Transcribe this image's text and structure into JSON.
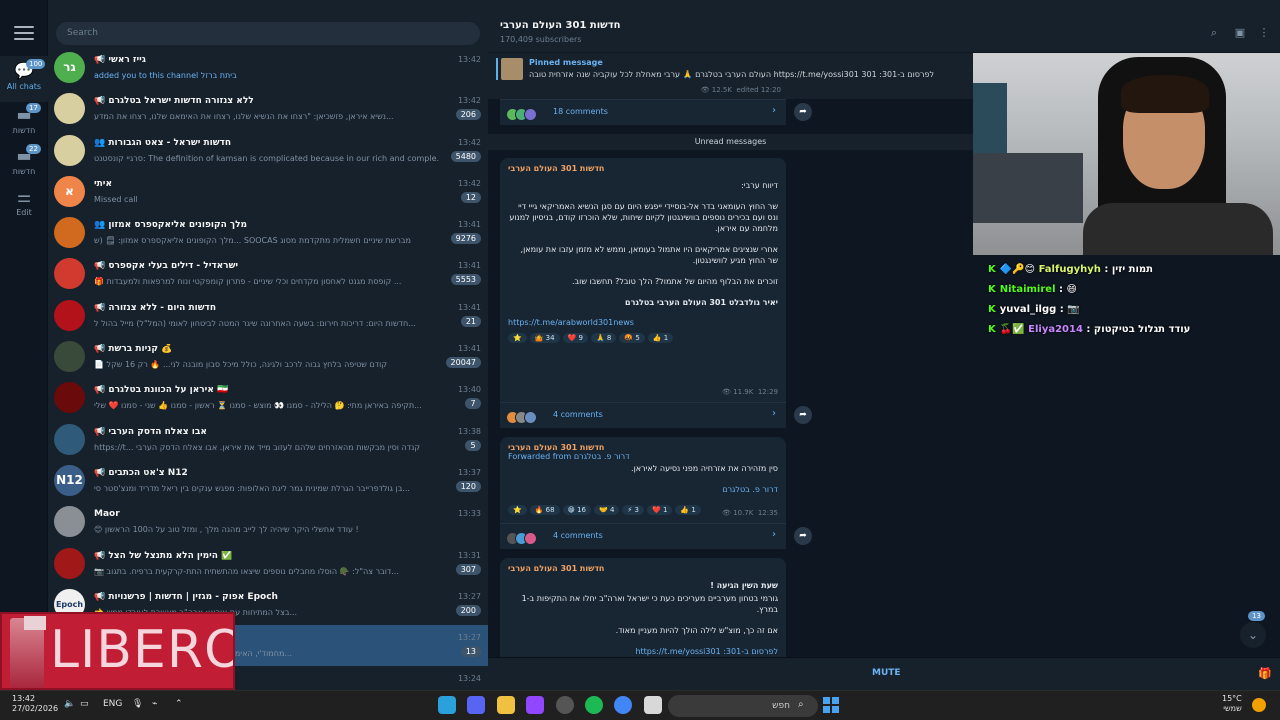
{
  "sidebar": {
    "folders": [
      {
        "label": "All chats",
        "count": "100",
        "icon": "chat-bubbles-icon"
      },
      {
        "label": "חדשות",
        "count": "17",
        "icon": "folder-icon"
      },
      {
        "label": "חדשות",
        "count": "22",
        "icon": "folder-icon"
      },
      {
        "label": "Edit",
        "count": "",
        "icon": "sliders-icon"
      }
    ]
  },
  "search": {
    "placeholder": "Search"
  },
  "chats": [
    {
      "title": "📢 גייז ראשי",
      "snippet": "added you to this channel ביתת ברזל",
      "time": "13:42",
      "badge": "",
      "avatar_text": "גר",
      "avatar_color": "#4fae4e",
      "blue": true
    },
    {
      "title": "📢 ללא צנזורה חדשות ישראל בטלגרם",
      "snippet": "נשיא איראן, פזשכיאן: \"רצחו את הנשיא שלנו, רצחו את האימאם שלנו, רצחו את המדע...",
      "time": "13:42",
      "badge": "206",
      "avatar_text": "",
      "avatar_color": "#d8cfa0",
      "blue": false
    },
    {
      "title": "👥 חדשות ישראל - צאט הגבורות",
      "snippet": "סרגיי קונסטנט: The definition of kamsan is complicated because in our rich and comple...",
      "time": "13:42",
      "badge": "5480",
      "avatar_text": "",
      "avatar_color": "#d8cfa0",
      "blue": false
    },
    {
      "title": "איתי",
      "snippet": "Missed call",
      "time": "13:42",
      "badge": "12",
      "avatar_text": "א",
      "avatar_color": "#f0854a",
      "blue": false
    },
    {
      "title": "👥 מלך הקופונים אליאקספרס אמזון",
      "snippet": "מלך הקופונים אליאקספרס אמזון: 🗒 (ש... SOOCAS מברשת שיניים חשמלית מתקדמת מסוג",
      "time": "13:41",
      "badge": "9276",
      "avatar_text": "",
      "avatar_color": "#d1691f",
      "blue": false
    },
    {
      "title": "📢 ישראדיל - דילים בעלי אקספרס",
      "snippet": "🎁 קופסת מגנט לאחסון מקדחים וכלי שיניים - פתרון קומפקטי ונוח למרפאות ולמעבדות ...",
      "time": "13:41",
      "badge": "5553",
      "avatar_text": "",
      "avatar_color": "#d03a2f",
      "blue": false
    },
    {
      "title": "📢 חדשות היום - ללא צנזורה",
      "snippet": "חדשות היום: דריכות חירום: בשעה האחרונה שיגר המטה לביטחון לאומי (המל\"ל) מייל בהול ל...",
      "time": "13:41",
      "badge": "21",
      "avatar_text": "",
      "avatar_color": "#b3121a",
      "blue": false
    },
    {
      "title": "📢 קניות ברשת 💰",
      "snippet": "📄 קודם שטיפה בלחץ גבוה לרכב ולגינה, כולל מיכל סבון מובנה לני... 🔥 רק 16 שקל",
      "time": "13:41",
      "badge": "20047",
      "avatar_text": "",
      "avatar_color": "#3a4a3a",
      "blue": false
    },
    {
      "title": "📢 איראן על הכוונת בטלגרם 🇮🇷",
      "snippet": "תקיפה באיראן מתי: 🤔 הלילה - סמנו 👀 מוצש - סמנו ⏳ ראשון - סמנו 👍 שני - סמנו ❤️ שלי...",
      "time": "13:40",
      "badge": "7",
      "avatar_text": "",
      "avatar_color": "#6a0a0a",
      "blue": false
    },
    {
      "title": "📢 אבו צאלח הדסק הערבי",
      "snippet": "https://t... קנדה וסין מבקשות מהאזרחים שלהם לעזוב מייד את איראן. אבו צאלח הדסק הערבי",
      "time": "13:38",
      "badge": "5",
      "avatar_text": "",
      "avatar_color": "#2f5a7a",
      "blue": false
    },
    {
      "title": "📢 צ'אט הכתבים N12",
      "snippet": "בן גולדפרייבר הגרלת שמינית גמר ליגת האלופות: מפגש ענקים בין ריאל מדריד ומנצ'סטר סי...",
      "time": "13:37",
      "badge": "120",
      "avatar_text": "N12",
      "avatar_color": "#3b5e88",
      "blue": false
    },
    {
      "title": "Maor",
      "snippet": "😊 עודד אחשלי היקר שיהיה לך לייב מהנה מלך , ומזל טוב על ה100 הראשון !",
      "time": "13:33",
      "badge": "",
      "avatar_text": "",
      "avatar_color": "#8a8f95",
      "blue": false
    },
    {
      "title": "📢 הימין הלא מתנצל של הצל ✅",
      "snippet": "📷 דובר צה\"ל: 🪖 הוסלו מחבלים נוספים שיצאו מהתשתית התת-קרקעית ברפיח. בתגוב...",
      "time": "13:31",
      "badge": "307",
      "avatar_text": "",
      "avatar_color": "#a01818",
      "blue": false
    },
    {
      "title": "📢 אפוק - מגזין | חדשות | פרשנויות Epoch",
      "snippet": "👈 בצל המתיחות עם איראן: ארה\"ב מאשרת לעובדי ממש...",
      "time": "13:27",
      "badge": "200",
      "avatar_text": "Epoch",
      "avatar_color": "#f0f0f0",
      "blue": false
    },
    {
      "title": "",
      "snippet": "מחמוד'י, האימאם של יום השישי בספהאן: \"על פי תפיסת...",
      "time": "13:27",
      "badge": "13",
      "avatar_text": "",
      "avatar_color": "#2b5278",
      "blue": false
    },
    {
      "title": "📢 חדשות ששון",
      "snippet": "",
      "time": "13:24",
      "badge": "",
      "avatar_text": "",
      "avatar_color": "#444",
      "blue": false
    }
  ],
  "channel": {
    "title": "חדשות 301 העולם הערבי",
    "subscribers": "170,409 subscribers",
    "pinned_label": "Pinned message",
    "pinned_text": "לפרסום ב-301: https://t.me/yossi301 301 העולם הערבי בטלגרם 🙏 ערבי מאחלת לכל עוקביה שנה אזרחית טובה",
    "pinned_views": "12.5K",
    "pinned_edited": "edited 12:20",
    "pinned_comments": "18 comments",
    "unread_label": "Unread messages",
    "mute_label": "MUTE",
    "scroll_badge": "13"
  },
  "messages": [
    {
      "sender": "חדשות 301 העולם הערבי",
      "paragraphs": [
        "דיווח ערבי:",
        "שר החוץ העומאני בדר אל-בוסיידי ייפגש היום עם סגן הנשיא האמריקאי גייי דיי ונס ועם בכירים נוספים בוושינגטון לקיום שיחות, שלא הוכרזו קודם, בניסיון למנוע מלחמה עם איראן.",
        "אחרי שנציגים אמריקאים היו אתמול בעומאן, וממש לא מזמן עזבו את עומאן, שר החוץ מגיע לוושינגטון.",
        "זוכרים את הבלוף מהיום של אתמול? הלך טובל? תחשבו שוב.",
        "יאיר גולדבלט 301 העולם הערבי בטלגרם"
      ],
      "link": "https://t.me/arabworld301news",
      "reactions": [
        "⭐",
        "🤷 34",
        "❤️ 9",
        "🙏 8",
        "🤬 5",
        "👍 1"
      ],
      "views": "11.9K",
      "time": "12:29",
      "comments": "4 comments"
    },
    {
      "sender": "חדשות 301 העולם הערבי",
      "forwarded": "Forwarded from  דרור פ. בטלגרם",
      "paragraphs": [
        "סין מזהירה את אזרחיה מפני נסיעה לאיראן."
      ],
      "signature": "דרור פ. בטלגרם",
      "reactions": [
        "⭐",
        "🔥 68",
        "😁 16",
        "🤝 4",
        "⚡ 3",
        "❤️ 1",
        "👍 1"
      ],
      "views": "10.7K",
      "time": "12:35",
      "comments": "4 comments"
    },
    {
      "sender": "חדשות 301 העולם הערבי",
      "paragraphs": [
        "שעת השין הגיעה !",
        "גורמי בטחון מערביים מעריכים כעת כי ישראל וארה\"ב יחלו את התקיפות ב-1 במרץ.",
        "אם זה כך, מוצ\"ש לילה הולך להיות מעניין מאוד."
      ],
      "link": "לפרסום ב-301: https://t.me/yossi301"
    }
  ],
  "stream_chat": [
    {
      "user": "Falfugyhyh",
      "badges": "🔷🔑😊",
      "message": "תמות יזין"
    },
    {
      "user": "Nitaimirel",
      "badges": "",
      "message": "😄"
    },
    {
      "user": "yuval_ilgg",
      "badges": "",
      "message": "📷"
    },
    {
      "user": "Eliya2014",
      "badges": "🍒✅",
      "message": "עודד תגלול בטיקטוק"
    }
  ],
  "ad": {
    "brand": "LIBERO"
  },
  "taskbar": {
    "time": "13:42",
    "date": "27/02/2026",
    "lang": "ENG",
    "search_placeholder": "חפש",
    "temp": "15°C",
    "weather": "שמשי"
  }
}
